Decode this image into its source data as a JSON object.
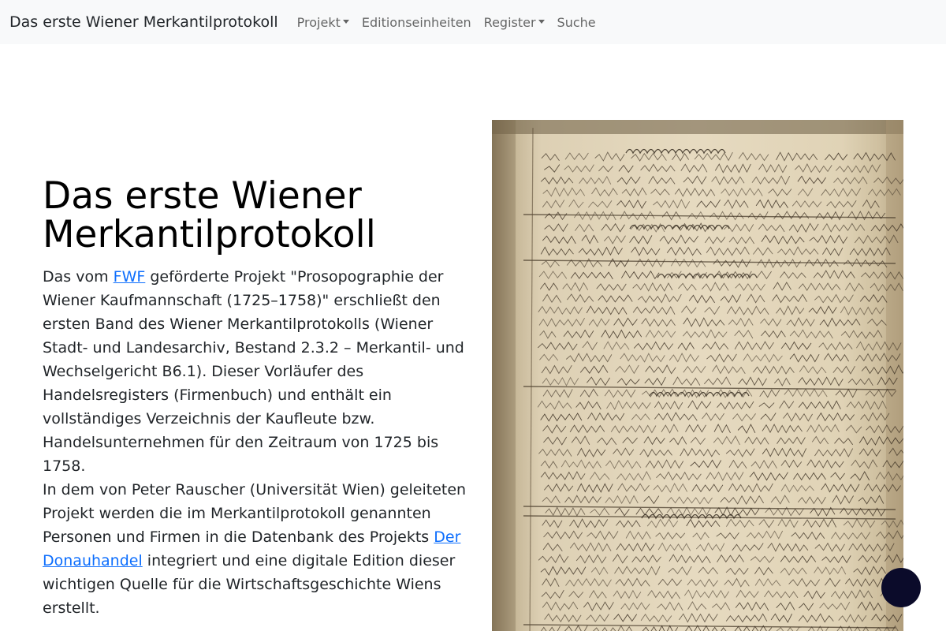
{
  "navbar": {
    "brand": "Das erste Wiener Merkantilprotokoll",
    "items": [
      {
        "label": "Projekt",
        "dropdown": true
      },
      {
        "label": "Editionseinheiten",
        "dropdown": false
      },
      {
        "label": "Register",
        "dropdown": true
      },
      {
        "label": "Suche",
        "dropdown": false
      }
    ]
  },
  "hero": {
    "title": "Das erste Wiener Merkantilprotokoll",
    "paragraph1_before_link": "Das vom ",
    "link_fwf": "FWF",
    "paragraph1_after_link": " geförderte Projekt \"Prosopographie der Wiener Kaufmannschaft (1725–1758)\" erschließt den ersten Band des Wiener Merkantilprotokolls (Wiener Stadt- und Landesarchiv, Bestand 2.3.2 – Merkantil- und Wechselgericht B6.1). Dieser Vorläufer des Handelsregisters (Firmenbuch) und enthält ein vollständiges Verzeichnis der Kaufleute bzw. Handelsunternehmen für den Zeitraum von 1725 bis 1758.",
    "paragraph2_before_link": "In dem von Peter Rauscher (Universität Wien) geleiteten Projekt werden die im Merkantilprotokoll genannten Personen und Firmen in die Datenbank des Projekts ",
    "link_donauhandel": "Der Donauhandel",
    "paragraph2_after_link": " integriert und eine digitale Edition dieser wichtigen Quelle für die Wirtschaftsgeschichte Wiens erstellt."
  },
  "colors": {
    "navbar_bg": "#f8f9fa",
    "link": "#0d6efd",
    "text": "#212529",
    "round_button": "#0b0b2a"
  }
}
